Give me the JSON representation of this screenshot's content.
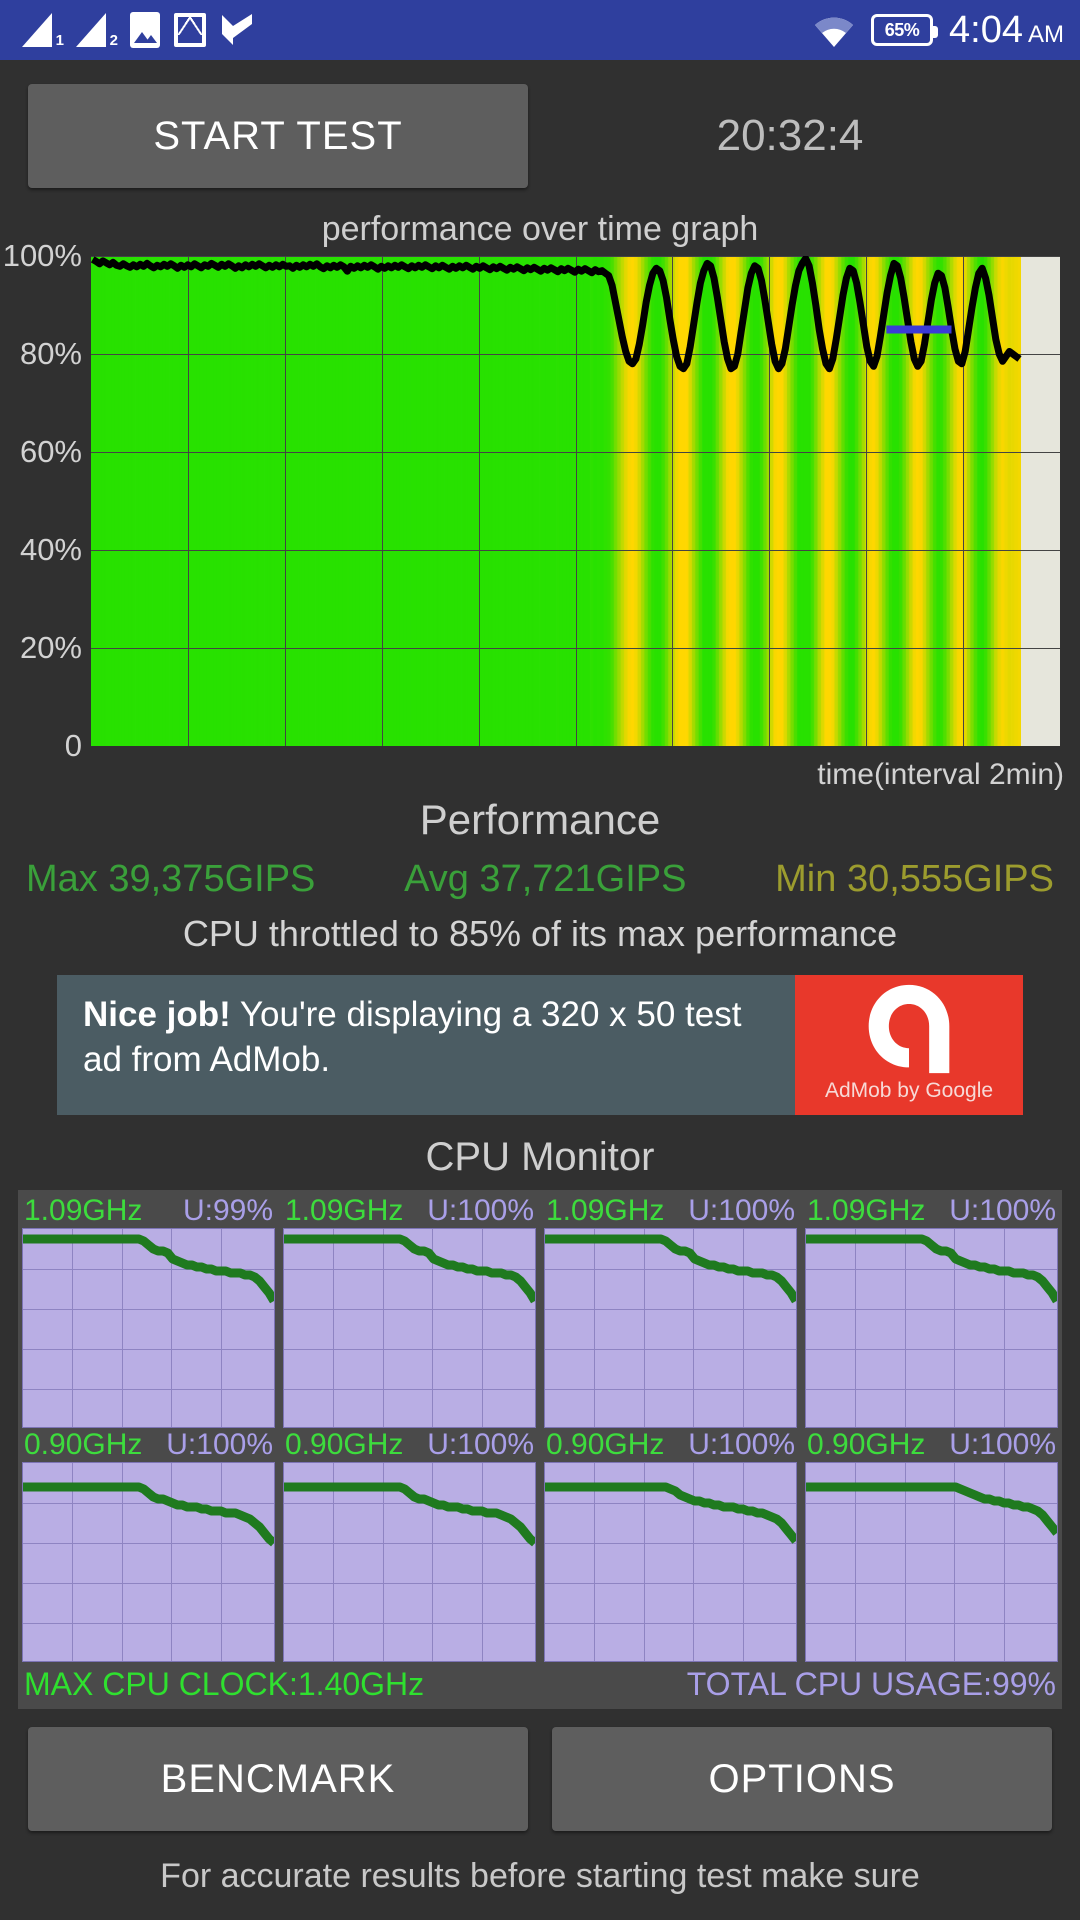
{
  "statusbar": {
    "signal1": "1",
    "signal2": "2",
    "icons": [
      "signal-1-icon",
      "signal-2-icon",
      "photos-icon",
      "gmail-icon",
      "tasks-icon",
      "wifi-icon"
    ],
    "battery": "65%",
    "time": "4:04",
    "ampm": "AM"
  },
  "controls": {
    "start_label": "START TEST",
    "timer": "20:32:4"
  },
  "chart_data": {
    "type": "area",
    "title": "performance over time graph",
    "xlabel": "time(interval 2min)",
    "ylabel": "",
    "ylim": [
      0,
      100
    ],
    "yticks": [
      0,
      20,
      40,
      60,
      80,
      100
    ],
    "ytick_labels": [
      "0",
      "20%",
      "40%",
      "60%",
      "80%",
      "100%"
    ],
    "grid": true,
    "x_gridlines": 9,
    "series": [
      {
        "name": "performance",
        "values": [
          99.3,
          98.9,
          98.4,
          99.0,
          98.6,
          98.2,
          98.7,
          98.1,
          97.9,
          98.4,
          98.0,
          97.7,
          98.2,
          97.8,
          98.3,
          97.9,
          98.5,
          98.0,
          97.6,
          98.1,
          97.8,
          98.3,
          97.9,
          98.4,
          98.0,
          97.5,
          98.1,
          97.7,
          98.2,
          97.8,
          98.4,
          98.0,
          97.6,
          98.2,
          97.9,
          98.5,
          98.1,
          97.7,
          98.3,
          97.9,
          98.4,
          98.0,
          97.5,
          98.0,
          97.6,
          98.2,
          97.8,
          98.3,
          97.9,
          98.4,
          98.0,
          97.6,
          98.1,
          97.7,
          98.2,
          97.8,
          98.3,
          97.9,
          98.0,
          97.5,
          98.1,
          97.7,
          98.2,
          97.8,
          98.3,
          97.9,
          98.4,
          97.8,
          97.4,
          98.0,
          97.6,
          98.1,
          97.7,
          98.2,
          97.8,
          96.9,
          97.9,
          97.5,
          98.0,
          97.6,
          98.1,
          97.7,
          98.2,
          97.8,
          97.3,
          97.9,
          97.5,
          98.0,
          97.6,
          98.1,
          97.7,
          98.2,
          97.8,
          97.4,
          98.0,
          97.6,
          98.1,
          97.7,
          98.2,
          97.8,
          97.4,
          98.0,
          97.6,
          98.1,
          97.7,
          97.3,
          97.9,
          97.5,
          98.0,
          97.6,
          98.1,
          97.7,
          97.3,
          97.9,
          97.5,
          98.0,
          97.6,
          97.2,
          97.8,
          97.4,
          97.9,
          97.5,
          97.1,
          97.7,
          97.3,
          97.8,
          97.4,
          97.0,
          97.6,
          97.2,
          97.7,
          97.3,
          96.9,
          97.5,
          97.1,
          97.6,
          97.2,
          96.8,
          97.4,
          97.0,
          97.5,
          97.1,
          96.7,
          97.3,
          96.9,
          97.4,
          97.0,
          96.6,
          97.2,
          96.8,
          97.0,
          96.5,
          96.0,
          94.0,
          90.5,
          87.0,
          83.5,
          80.5,
          78.5,
          78.0,
          79.0,
          82.0,
          86.0,
          90.5,
          94.0,
          96.5,
          97.5,
          97.0,
          95.0,
          91.5,
          87.0,
          83.0,
          79.5,
          77.5,
          77.0,
          78.0,
          81.5,
          86.0,
          90.5,
          94.5,
          97.0,
          98.5,
          98.0,
          95.5,
          91.5,
          87.0,
          82.5,
          79.0,
          77.0,
          77.5,
          80.0,
          84.5,
          89.0,
          93.5,
          96.5,
          98.0,
          97.5,
          95.0,
          91.0,
          86.5,
          82.0,
          78.5,
          77.0,
          78.0,
          81.0,
          85.5,
          90.0,
          94.0,
          97.0,
          98.5,
          99.5,
          98.0,
          94.5,
          90.0,
          85.0,
          81.0,
          78.0,
          77.0,
          79.0,
          83.0,
          87.5,
          92.0,
          95.5,
          97.5,
          97.0,
          94.5,
          90.5,
          86.0,
          81.5,
          78.5,
          77.5,
          79.5,
          83.5,
          88.0,
          92.5,
          96.0,
          98.5,
          98.0,
          95.5,
          91.5,
          87.0,
          82.5,
          79.0,
          77.5,
          78.5,
          82.0,
          86.5,
          91.0,
          94.5,
          96.5,
          96.0,
          93.5,
          89.5,
          85.0,
          81.0,
          78.5,
          78.0,
          80.5,
          85.0,
          89.5,
          93.5,
          96.5,
          97.5,
          95.5,
          92.0,
          87.5,
          83.0,
          80.0,
          78.5,
          79.5,
          80.5,
          80.0,
          79.5,
          79.0
        ]
      }
    ],
    "annotation": {
      "name": "throttle-level-marker",
      "color": "#3b3bd6",
      "y": 85
    }
  },
  "performance": {
    "heading": "Performance",
    "max_label": "Max 39,375GIPS",
    "avg_label": "Avg 37,721GIPS",
    "min_label": "Min 30,555GIPS",
    "max_color": "#3aa03a",
    "avg_color": "#3aa03a",
    "min_color": "#9c9c2e",
    "note": "CPU throttled to 85% of its max performance"
  },
  "ad": {
    "headline": "Nice job!",
    "body": " You're displaying a 320 x 50 test ad from AdMob.",
    "brand": "AdMob by Google",
    "bg": "#4b5c63",
    "logo_bg": "#e8382b"
  },
  "cpu_monitor": {
    "title": "CPU Monitor",
    "cores": [
      {
        "freq": "1.09GHz",
        "usage": "U:99%",
        "trace": [
          95,
          95,
          95,
          95,
          95,
          95,
          95,
          95,
          95,
          95,
          95,
          95,
          95,
          95,
          95,
          95,
          95,
          95,
          95,
          95,
          95,
          95,
          95,
          95,
          95,
          94,
          92,
          90,
          89,
          89,
          88,
          85,
          84,
          83,
          82,
          82,
          81,
          81,
          80,
          80,
          79,
          79,
          79,
          78,
          78,
          78,
          77,
          77,
          76,
          74,
          71,
          68,
          64
        ]
      },
      {
        "freq": "1.09GHz",
        "usage": "U:100%",
        "trace": [
          95,
          95,
          95,
          95,
          95,
          95,
          95,
          95,
          95,
          95,
          95,
          95,
          95,
          95,
          95,
          95,
          95,
          95,
          95,
          95,
          95,
          95,
          95,
          95,
          95,
          94,
          92,
          90,
          89,
          89,
          88,
          85,
          84,
          83,
          82,
          82,
          81,
          81,
          80,
          80,
          79,
          79,
          79,
          78,
          78,
          78,
          77,
          77,
          76,
          74,
          71,
          68,
          64
        ]
      },
      {
        "freq": "1.09GHz",
        "usage": "U:100%",
        "trace": [
          95,
          95,
          95,
          95,
          95,
          95,
          95,
          95,
          95,
          95,
          95,
          95,
          95,
          95,
          95,
          95,
          95,
          95,
          95,
          95,
          95,
          95,
          95,
          95,
          95,
          94,
          92,
          90,
          89,
          89,
          88,
          85,
          84,
          83,
          82,
          82,
          81,
          81,
          80,
          80,
          79,
          79,
          79,
          78,
          78,
          78,
          77,
          77,
          76,
          74,
          71,
          68,
          64
        ]
      },
      {
        "freq": "1.09GHz",
        "usage": "U:100%",
        "trace": [
          95,
          95,
          95,
          95,
          95,
          95,
          95,
          95,
          95,
          95,
          95,
          95,
          95,
          95,
          95,
          95,
          95,
          95,
          95,
          95,
          95,
          95,
          95,
          95,
          95,
          94,
          92,
          90,
          89,
          89,
          88,
          85,
          84,
          83,
          82,
          82,
          81,
          81,
          80,
          80,
          79,
          79,
          79,
          78,
          78,
          78,
          77,
          77,
          76,
          74,
          71,
          68,
          64
        ]
      },
      {
        "freq": "0.90GHz",
        "usage": "U:100%",
        "trace": [
          88,
          88,
          88,
          88,
          88,
          88,
          88,
          88,
          88,
          88,
          88,
          88,
          88,
          88,
          88,
          88,
          88,
          88,
          88,
          88,
          88,
          88,
          88,
          88,
          88,
          87,
          85,
          83,
          82,
          82,
          81,
          80,
          79,
          79,
          78,
          78,
          78,
          77,
          77,
          76,
          76,
          76,
          75,
          75,
          75,
          74,
          73,
          72,
          70,
          68,
          65,
          62,
          60
        ]
      },
      {
        "freq": "0.90GHz",
        "usage": "U:100%",
        "trace": [
          88,
          88,
          88,
          88,
          88,
          88,
          88,
          88,
          88,
          88,
          88,
          88,
          88,
          88,
          88,
          88,
          88,
          88,
          88,
          88,
          88,
          88,
          88,
          88,
          88,
          87,
          85,
          83,
          82,
          82,
          81,
          80,
          79,
          79,
          78,
          78,
          78,
          77,
          77,
          76,
          76,
          76,
          75,
          75,
          75,
          74,
          73,
          72,
          70,
          68,
          65,
          62,
          60
        ]
      },
      {
        "freq": "0.90GHz",
        "usage": "U:100%",
        "trace": [
          88,
          88,
          88,
          88,
          88,
          88,
          88,
          88,
          88,
          88,
          88,
          88,
          88,
          88,
          88,
          88,
          88,
          88,
          88,
          88,
          88,
          88,
          88,
          88,
          88,
          88,
          87,
          86,
          84,
          83,
          82,
          81,
          81,
          80,
          80,
          79,
          79,
          78,
          78,
          78,
          77,
          77,
          76,
          76,
          75,
          75,
          74,
          73,
          72,
          70,
          67,
          64,
          61
        ]
      },
      {
        "freq": "0.90GHz",
        "usage": "U:100%",
        "trace": [
          88,
          88,
          88,
          88,
          88,
          88,
          88,
          88,
          88,
          88,
          88,
          88,
          88,
          88,
          88,
          88,
          88,
          88,
          88,
          88,
          88,
          88,
          88,
          88,
          88,
          88,
          88,
          88,
          88,
          88,
          88,
          88,
          87,
          86,
          85,
          84,
          83,
          82,
          82,
          81,
          81,
          80,
          80,
          79,
          79,
          78,
          78,
          77,
          76,
          74,
          71,
          68,
          65
        ]
      }
    ],
    "max_clock": "MAX CPU CLOCK:1.40GHz",
    "total_usage": "TOTAL CPU USAGE:99%"
  },
  "bottom": {
    "bencmark_label": "BENCMARK",
    "options_label": "OPTIONS",
    "footnote": "For accurate results before starting test make sure"
  }
}
